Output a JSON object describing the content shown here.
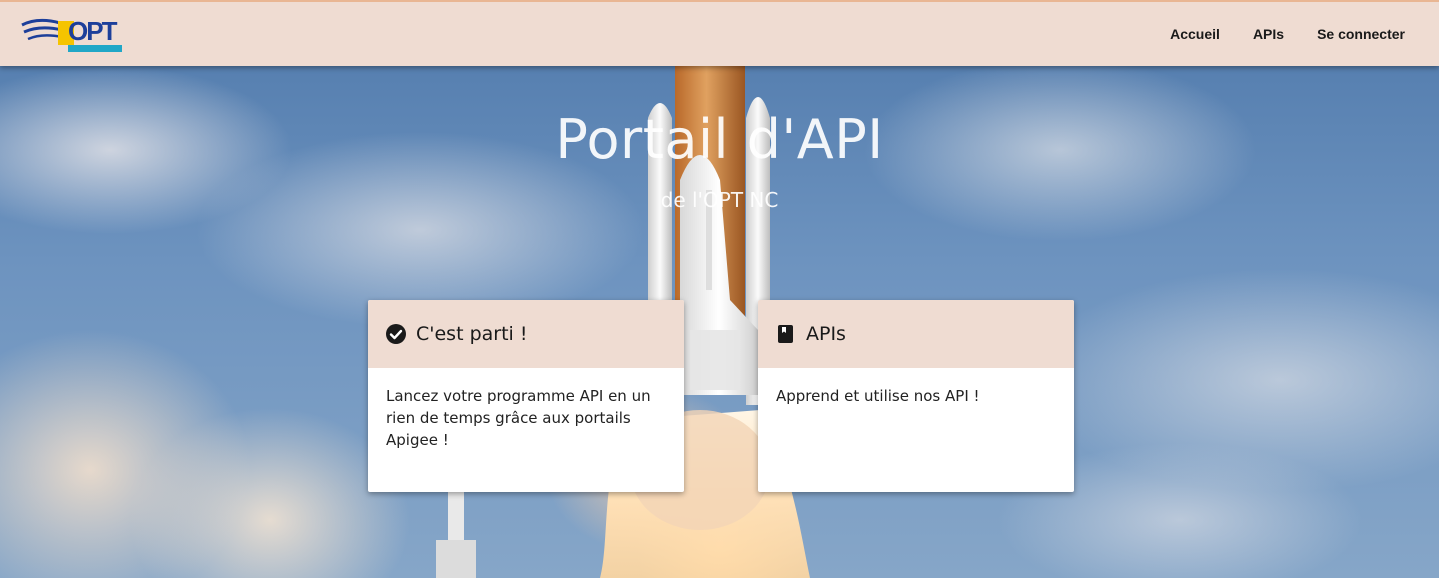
{
  "header": {
    "logo_text": "OPT",
    "nav": [
      "Accueil",
      "APIs",
      "Se connecter"
    ]
  },
  "hero": {
    "title": "Portail d'API",
    "subtitle": "de l'OPT NC"
  },
  "cards": [
    {
      "icon": "check-circle-icon",
      "title": "C'est parti !",
      "body": "Lancez votre programme API en un rien de temps grâce aux portails Apigee !"
    },
    {
      "icon": "book-icon",
      "title": "APIs",
      "body": "Apprend et utilise nos API !"
    }
  ],
  "colors": {
    "header_bg": "#efdcd2",
    "header_border": "#e9b693",
    "logo_blue": "#1d3f9a",
    "logo_yellow": "#f5c400"
  }
}
